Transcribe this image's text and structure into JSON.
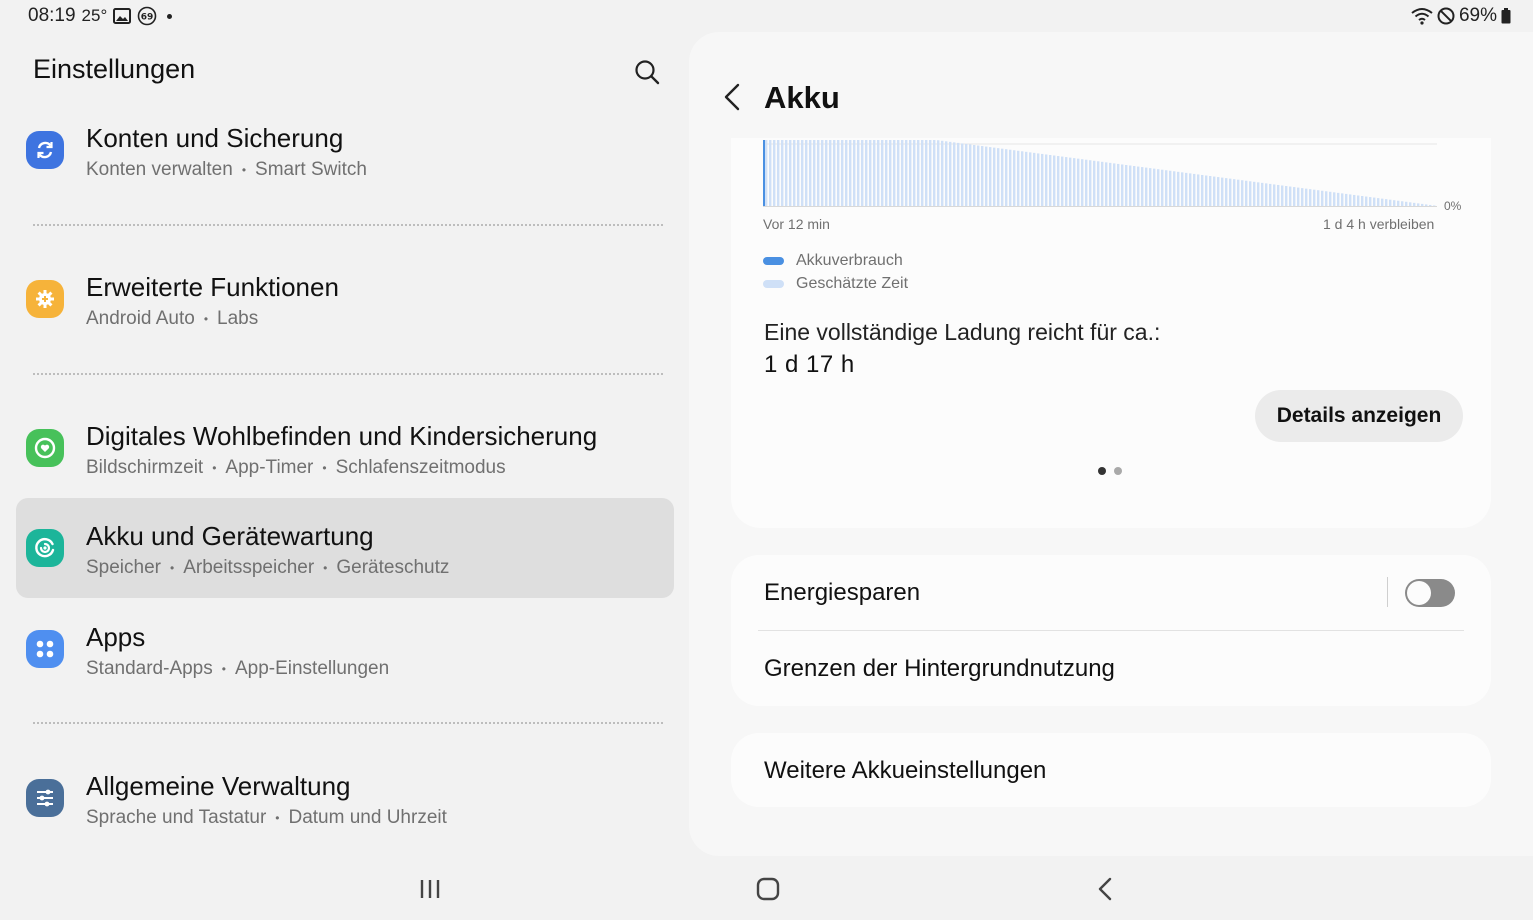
{
  "status_bar": {
    "time": "08:19",
    "temperature": "25°",
    "battery_percent": "69%",
    "icons": [
      "image-icon",
      "badge-69-icon",
      "notification-dot-icon",
      "wifi-icon",
      "do-not-disturb-icon",
      "battery-icon"
    ]
  },
  "left_pane": {
    "title": "Einstellungen",
    "search_icon": "search-icon",
    "items": [
      {
        "title": "Konten und Sicherung",
        "subs": [
          "Konten verwalten",
          "Smart Switch"
        ],
        "icon": "sync-icon",
        "color": "#3e74e0",
        "selected": false
      },
      {
        "title": "Erweiterte Funktionen",
        "subs": [
          "Android Auto",
          "Labs"
        ],
        "icon": "gear-plus-icon",
        "color": "#f6b33a",
        "selected": false
      },
      {
        "title": "Digitales Wohlbefinden und Kindersicherung",
        "subs": [
          "Bildschirmzeit",
          "App-Timer",
          "Schlafenszeitmodus"
        ],
        "icon": "wellbeing-icon",
        "color": "#47c15a",
        "selected": false
      },
      {
        "title": "Akku und Gerätewartung",
        "subs": [
          "Speicher",
          "Arbeitsspeicher",
          "Geräteschutz"
        ],
        "icon": "device-care-icon",
        "color": "#1cb59a",
        "selected": true
      },
      {
        "title": "Apps",
        "subs": [
          "Standard-Apps",
          "App-Einstellungen"
        ],
        "icon": "apps-grid-icon",
        "color": "#4f8ff0",
        "selected": false
      },
      {
        "title": "Allgemeine Verwaltung",
        "subs": [
          "Sprache und Tastatur",
          "Datum und Uhrzeit"
        ],
        "icon": "sliders-icon",
        "color": "#4a6f99",
        "selected": false
      }
    ]
  },
  "right_pane": {
    "title": "Akku",
    "chart": {
      "y_label_right": "0%",
      "x_label_left": "Vor 12 min",
      "x_label_right": "1 d 4 h verbleiben",
      "legend": [
        {
          "label": "Akkuverbrauch",
          "color": "#4a90e2"
        },
        {
          "label": "Geschätzte Zeit",
          "color": "#cfe0f7"
        }
      ]
    },
    "full_charge_label": "Eine vollständige Ladung reicht für ca.:",
    "full_charge_value": "1 d 17 h",
    "details_button": "Details anzeigen",
    "pager": {
      "count": 2,
      "active": 0
    },
    "power_saving_label": "Energiesparen",
    "power_saving_enabled": false,
    "background_limits_label": "Grenzen der Hintergrundnutzung",
    "more_settings_label": "Weitere Akkueinstellungen"
  },
  "nav_bar": {
    "recents_icon": "recents-icon",
    "home_icon": "home-icon",
    "back_icon": "back-icon"
  }
}
